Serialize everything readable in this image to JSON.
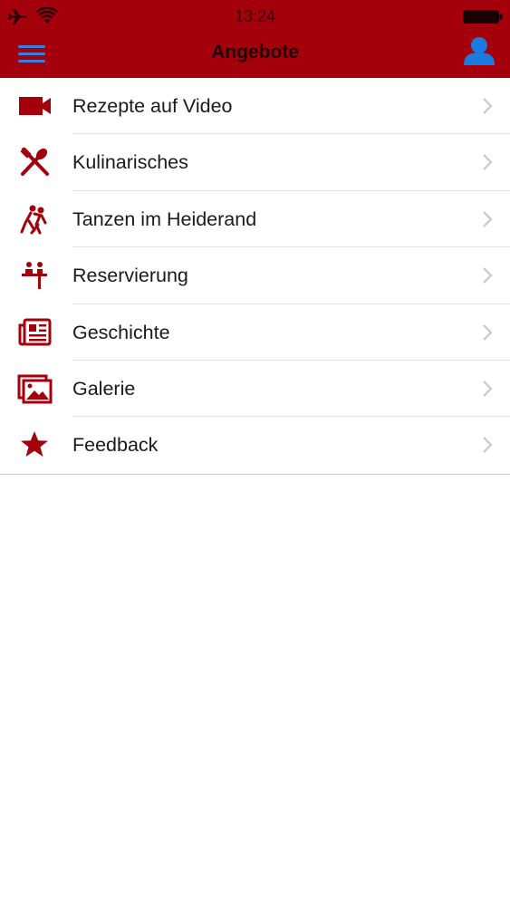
{
  "status_bar": {
    "time": "13:24",
    "icons": [
      "airplane-icon",
      "wifi-icon",
      "battery-icon"
    ]
  },
  "header": {
    "title": "Angebote",
    "menu_icon": "hamburger-menu-icon",
    "profile_icon": "user-profile-icon"
  },
  "colors": {
    "brand_red": "#a4000b",
    "accent_blue": "#1a7be0",
    "chevron_gray": "#c7c7cc"
  },
  "menu": {
    "items": [
      {
        "label": "Rezepte auf Video",
        "icon": "video-camera-icon"
      },
      {
        "label": "Kulinarisches",
        "icon": "fork-spoon-icon"
      },
      {
        "label": "Tanzen im Heiderand",
        "icon": "dancing-couple-icon"
      },
      {
        "label": "Reservierung",
        "icon": "reservation-table-icon"
      },
      {
        "label": "Geschichte",
        "icon": "newspaper-icon"
      },
      {
        "label": "Galerie",
        "icon": "gallery-icon"
      },
      {
        "label": "Feedback",
        "icon": "star-icon"
      }
    ]
  }
}
